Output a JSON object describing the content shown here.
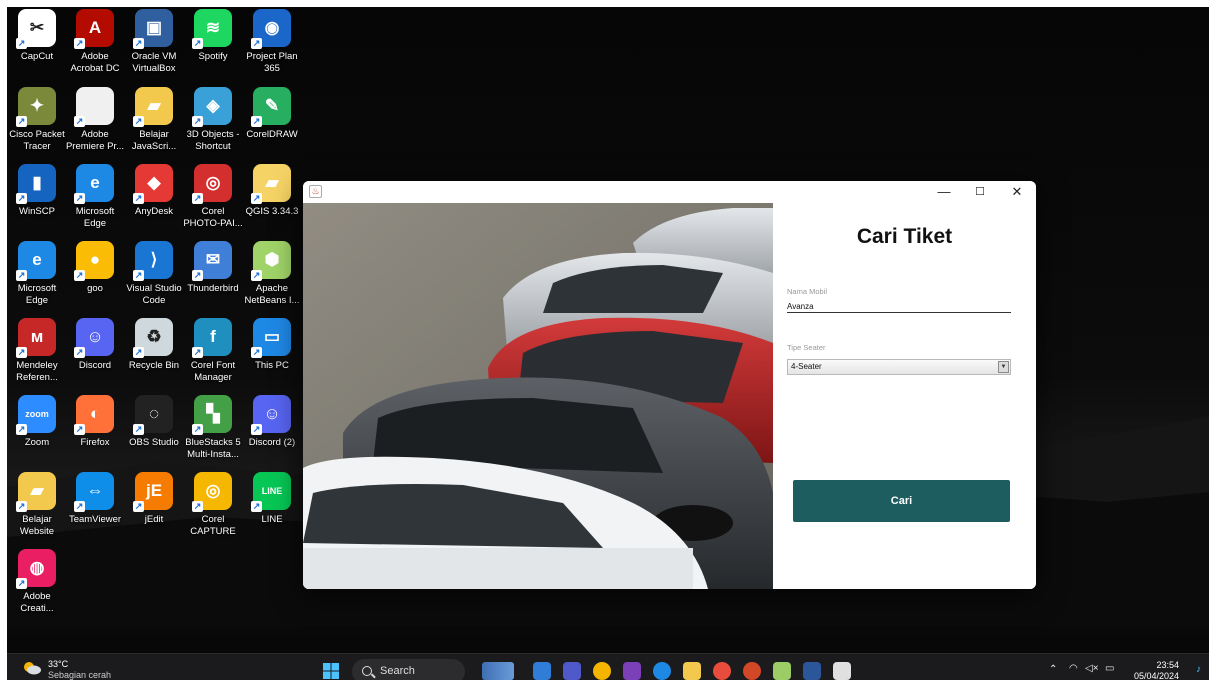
{
  "desktop": {
    "icons": [
      {
        "label": "CapCut",
        "color": "#ffffff",
        "glyph": "✂"
      },
      {
        "label": "Adobe Acrobat DC",
        "color": "#b30b00",
        "glyph": "A"
      },
      {
        "label": "Oracle VM VirtualBox",
        "color": "#2f5f9e",
        "glyph": "▣"
      },
      {
        "label": "Spotify",
        "color": "#1ed760",
        "glyph": "≋"
      },
      {
        "label": "Project Plan 365",
        "color": "#1b67c9",
        "glyph": "◉"
      },
      {
        "label": "Cisco Packet Tracer",
        "color": "#7a8a3a",
        "glyph": "✦"
      },
      {
        "label": "Adobe Premiere Pr...",
        "color": "#f0f0f0",
        "glyph": ""
      },
      {
        "label": "Belajar JavaScri...",
        "color": "#f2c94c",
        "glyph": "▰"
      },
      {
        "label": "3D Objects - Shortcut",
        "color": "#3aa0d8",
        "glyph": "◈"
      },
      {
        "label": "CorelDRAW",
        "color": "#27ae60",
        "glyph": "✎"
      },
      {
        "label": "WinSCP",
        "color": "#1565c0",
        "glyph": "▮"
      },
      {
        "label": "Microsoft Edge",
        "color": "#1e88e5",
        "glyph": "e"
      },
      {
        "label": "AnyDesk",
        "color": "#e53935",
        "glyph": "◆"
      },
      {
        "label": "Corel PHOTO-PAI...",
        "color": "#d32f2f",
        "glyph": "◎"
      },
      {
        "label": "QGIS 3.34.3",
        "color": "#f6d365",
        "glyph": "▰"
      },
      {
        "label": "Microsoft Edge",
        "color": "#1e88e5",
        "glyph": "e"
      },
      {
        "label": "goo",
        "color": "#fbbc05",
        "glyph": "●"
      },
      {
        "label": "Visual Studio Code",
        "color": "#1976d2",
        "glyph": "⟩"
      },
      {
        "label": "Thunderbird",
        "color": "#3f7fd8",
        "glyph": "✉"
      },
      {
        "label": "Apache NetBeans I...",
        "color": "#a0d468",
        "glyph": "⬢"
      },
      {
        "label": "Mendeley Referen...",
        "color": "#c62828",
        "glyph": "ᴍ"
      },
      {
        "label": "Discord",
        "color": "#5865f2",
        "glyph": "☺"
      },
      {
        "label": "Recycle Bin",
        "color": "#cfd8dc",
        "glyph": "♻"
      },
      {
        "label": "Corel Font Manager",
        "color": "#1f8fbf",
        "glyph": "f"
      },
      {
        "label": "This PC",
        "color": "#1e88e5",
        "glyph": "▭"
      },
      {
        "label": "Zoom",
        "color": "#2d8cff",
        "glyph": "zoom"
      },
      {
        "label": "Firefox",
        "color": "#ff7139",
        "glyph": "◐"
      },
      {
        "label": "OBS Studio",
        "color": "#222222",
        "glyph": "◌"
      },
      {
        "label": "BlueStacks 5 Multi-Insta...",
        "color": "#43a047",
        "glyph": "▚"
      },
      {
        "label": "Discord (2)",
        "color": "#5865f2",
        "glyph": "☺"
      },
      {
        "label": "Belajar Website",
        "color": "#f2c94c",
        "glyph": "▰"
      },
      {
        "label": "TeamViewer",
        "color": "#0e8ee9",
        "glyph": "⇔"
      },
      {
        "label": "jEdit",
        "color": "#f57c00",
        "glyph": "jE"
      },
      {
        "label": "Corel CAPTURE",
        "color": "#f5b700",
        "glyph": "◎"
      },
      {
        "label": "LINE",
        "color": "#06c755",
        "glyph": "LINE"
      },
      {
        "label": "Adobe Creati...",
        "color": "#e91e63",
        "glyph": "◍"
      }
    ]
  },
  "window": {
    "minimize": "—",
    "maximize": "☐",
    "close": "✕",
    "form": {
      "title": "Cari Tiket",
      "nama_label": "Nama Mobil",
      "nama_value": "Avanza",
      "tipe_label": "Tipe Seater",
      "tipe_value": "4-Seater",
      "button_label": "Cari"
    }
  },
  "taskbar": {
    "weather_temp": "33°C",
    "weather_desc": "Sebagian cerah",
    "search_placeholder": "Search",
    "time": "23:54",
    "date": "05/04/2024"
  }
}
